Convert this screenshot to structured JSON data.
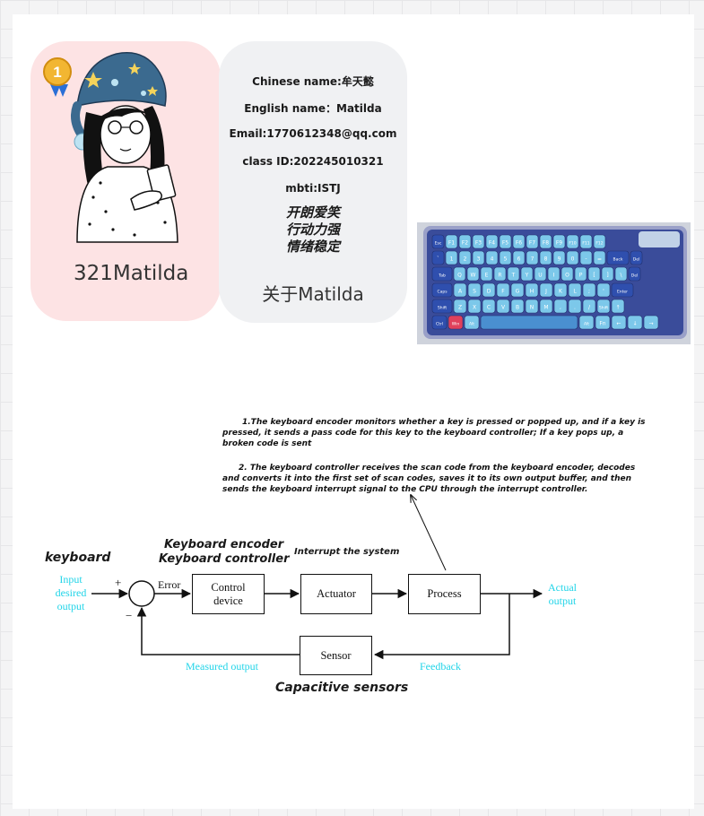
{
  "profile": {
    "display_name": "321Matilda",
    "chinese_name": "Chinese name:牟天懿",
    "english_name": "English name：Matilda",
    "email": "Email:1770612348@qq.com",
    "class_id": "class ID:202245010321",
    "mbti": "mbti:ISTJ",
    "traits": [
      "开朗爱笑",
      "行动力强",
      "情绪稳定"
    ],
    "about": "关于Matilda",
    "badge_number": "1"
  },
  "notes": {
    "point1": "1.The keyboard encoder monitors whether a key is pressed or popped up, and if a key is pressed, it sends a pass code for this key to the keyboard controller; If a key pops up, a broken code is sent",
    "point2": "2. The keyboard controller receives the scan code from the keyboard encoder, decodes and converts it into the first set of scan codes, saves it to its own output buffer, and then sends the keyboard interrupt signal to the CPU through the interrupt controller."
  },
  "diagram": {
    "label_keyboard": "keyboard",
    "label_encoder": "Keyboard encoder",
    "label_controller": "Keyboard controller",
    "label_interrupt": "Interrupt the system",
    "label_sensors": "Capacitive sensors",
    "input_lines": [
      "Input",
      "desired",
      "output"
    ],
    "output_lines": [
      "Actual",
      "output"
    ],
    "plus": "+",
    "minus": "−",
    "error": "Error",
    "control_device": [
      "Control",
      "device"
    ],
    "actuator": "Actuator",
    "process": "Process",
    "sensor": "Sensor",
    "measured_output": "Measured output",
    "feedback": "Feedback"
  },
  "keyboard_photo": {
    "keys_row1": [
      "Esc",
      "F1",
      "F2",
      "F3",
      "F4",
      "F5",
      "F6",
      "F7",
      "F8",
      "F9",
      "F10",
      "F11",
      "F12"
    ],
    "keys_row3": [
      "Tab",
      "Q",
      "W",
      "E",
      "R",
      "T",
      "Y",
      "U",
      "I",
      "O",
      "P",
      "[",
      "]",
      "\\"
    ],
    "keys_row4": [
      "Caps",
      "A",
      "S",
      "D",
      "F",
      "G",
      "H",
      "J",
      "K",
      "L",
      ";",
      "'",
      "Enter"
    ],
    "keys_row5": [
      "Shift",
      "Z",
      "X",
      "C",
      "V",
      "B",
      "N",
      "M",
      ",",
      ".",
      "/",
      "Shift",
      "↑"
    ],
    "key_back": "Back",
    "key_del": "Del",
    "colors": {
      "case": "#9aa0c8",
      "key_light": "#7cc8ea",
      "key_dark": "#2f4fae",
      "accent_red": "#e0415b"
    }
  },
  "colors": {
    "pink_card": "#fde3e4",
    "grey_card": "#f0f1f3",
    "cyan_label": "#20d4e8",
    "hat": "#3b6a8f",
    "badge": "#f2b632"
  }
}
